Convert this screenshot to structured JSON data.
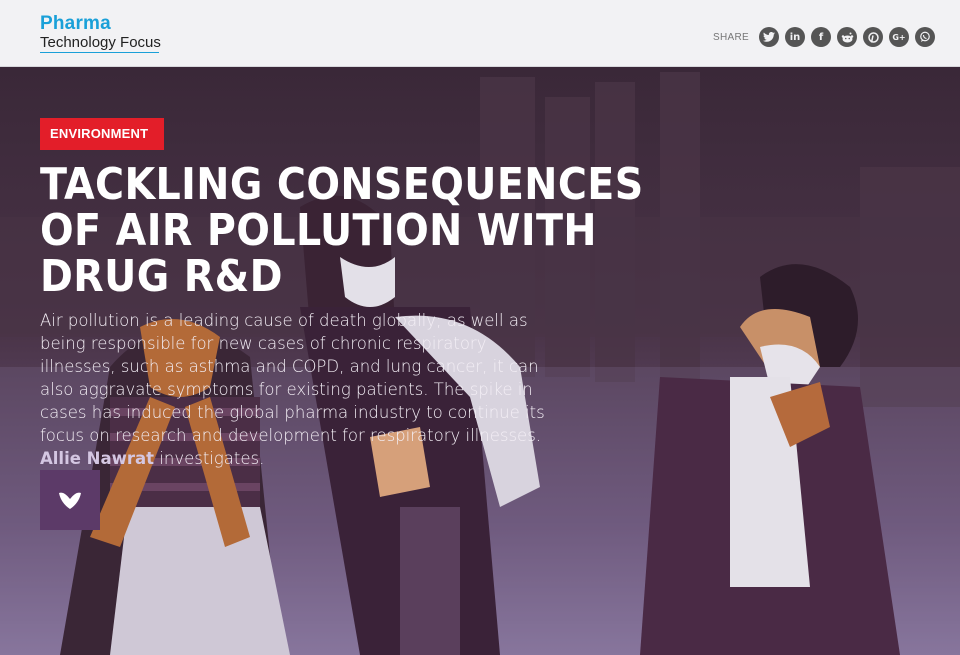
{
  "header": {
    "logo_line1": "Pharma",
    "logo_line2": "Technology Focus",
    "share_label": "SHARE",
    "share_icons": [
      "twitter-icon",
      "linkedin-icon",
      "facebook-icon",
      "reddit-icon",
      "pinterest-icon",
      "google-plus-icon",
      "whatsapp-icon"
    ],
    "share_glyphs": {
      "linkedin": "in",
      "facebook": "f",
      "google_plus": "G+"
    }
  },
  "hero": {
    "category": "ENVIRONMENT",
    "title": "TACKLING CONSEQUENCES OF AIR POLLUTION WITH DRUG R&D",
    "intro_text": "Air pollution is a leading cause of death globally; as well as being responsible for new cases of chronic respiratory illnesses, such as asthma and COPD, and lung cancer, it can also aggravate symptoms for existing patients. The spike in cases has induced the global pharma industry to continue its focus on research and development for respiratory illnesses.",
    "author": "Allie Nawrat",
    "intro_suffix": "investigates.",
    "scroll_icon": "chevron-down-icon"
  },
  "colors": {
    "brand_blue": "#1aa0d8",
    "tag_red": "#e31e29",
    "scroll_button": "#5c3a68",
    "author_highlight": "#d4c7e2"
  }
}
